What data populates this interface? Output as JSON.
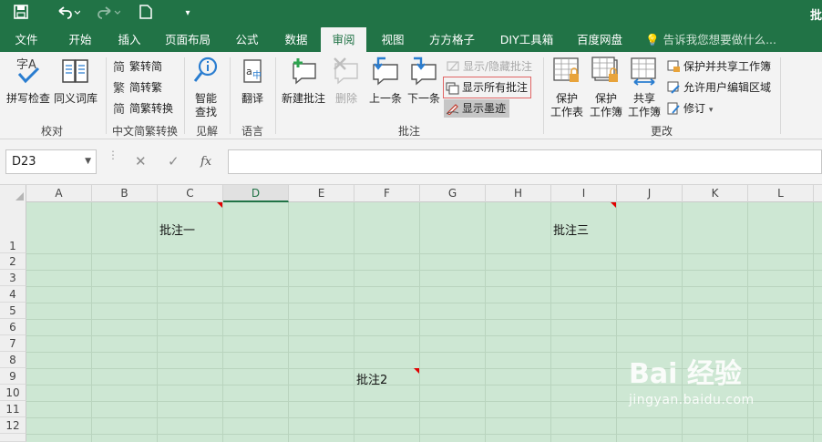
{
  "window": {
    "title": "批"
  },
  "qat": {
    "save": "save-icon",
    "undo": "undo-icon",
    "redo": "redo-icon",
    "new": "new-file-icon",
    "customize": "customize-icon"
  },
  "tabs": [
    {
      "label": "文件"
    },
    {
      "label": "开始"
    },
    {
      "label": "插入"
    },
    {
      "label": "页面布局"
    },
    {
      "label": "公式"
    },
    {
      "label": "数据"
    },
    {
      "label": "审阅"
    },
    {
      "label": "视图"
    },
    {
      "label": "方方格子"
    },
    {
      "label": "DIY工具箱"
    },
    {
      "label": "百度网盘"
    }
  ],
  "active_tab": "审阅",
  "tell_me": "告诉我您想要做什么...",
  "ribbon": {
    "proofing": {
      "label": "校对",
      "spell": "拼写检查",
      "thesaurus": "同义词库"
    },
    "chinese": {
      "label": "中文简繁转换",
      "to_simple": "繁转简",
      "to_trad": "简转繁",
      "convert": "简繁转换"
    },
    "insights": {
      "label": "见解",
      "smart_lookup_1": "智能",
      "smart_lookup_2": "查找"
    },
    "language": {
      "label": "语言",
      "translate": "翻译"
    },
    "comments": {
      "label": "批注",
      "new": "新建批注",
      "delete": "删除",
      "prev": "上一条",
      "next": "下一条",
      "show_hide": "显示/隐藏批注",
      "show_all": "显示所有批注",
      "show_ink": "显示墨迹"
    },
    "changes": {
      "label": "更改",
      "protect_sheet_1": "保护",
      "protect_sheet_2": "工作表",
      "protect_wb_1": "保护",
      "protect_wb_2": "工作簿",
      "share_1": "共享",
      "share_2": "工作簿",
      "protect_share": "保护并共享工作簿",
      "allow_edit": "允许用户编辑区域",
      "track": "修订"
    }
  },
  "formula_bar": {
    "name_box": "D23",
    "cancel": "✕",
    "enter": "✓",
    "fx": "fx",
    "value": ""
  },
  "columns": [
    "A",
    "B",
    "C",
    "D",
    "E",
    "F",
    "G",
    "H",
    "I",
    "J",
    "K",
    "L"
  ],
  "active_column": "D",
  "rows": [
    "1",
    "2",
    "3",
    "4",
    "5",
    "6",
    "7",
    "8",
    "9",
    "10",
    "11",
    "12"
  ],
  "comments": [
    {
      "cell": "C1",
      "text": "批注一"
    },
    {
      "cell": "I1",
      "text": "批注三"
    },
    {
      "cell": "F9",
      "text": "批注2"
    }
  ],
  "watermark": {
    "brand": "Bai  经验",
    "url": "jingyan.baidu.com"
  },
  "colors": {
    "accent": "#217346",
    "sheet_tint": "#cde7d3",
    "comment_marker": "#e00000"
  }
}
